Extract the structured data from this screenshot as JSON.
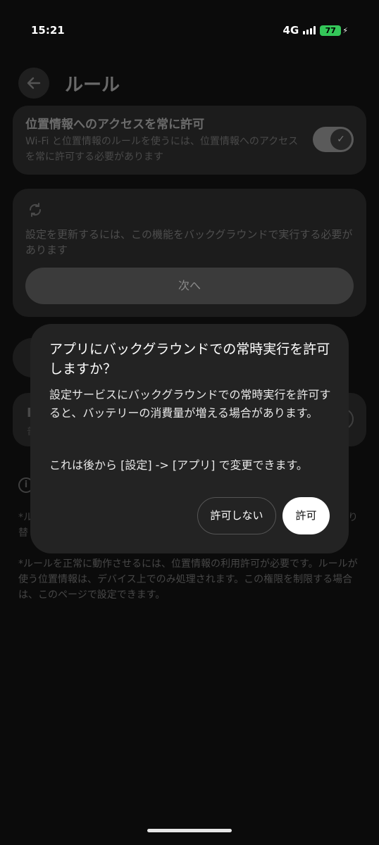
{
  "status_bar": {
    "time": "15:21",
    "network": "4G",
    "battery": "77",
    "battery_color": "#34c759"
  },
  "header": {
    "title": "ルール",
    "back_icon": "arrow-left-icon"
  },
  "location_card": {
    "title": "位置情報へのアクセスを常に許可",
    "subtitle": "Wi-Fi と位置情報のルールを使うには、位置情報へのアクセスを常に許可する必要があります",
    "toggle_checked": true
  },
  "background_card": {
    "icon": "refresh-icon",
    "text": "設定を更新するには、この機能をバックグラウンドで実行する必要があります",
    "next_label": "次へ"
  },
  "hidden_card": {
    "letter": "B",
    "sub": "普"
  },
  "info": {
    "side_left_1": "*ル",
    "side_left_2": "替",
    "side_right_1": "り",
    "note": "*ルールを正常に動作させるには、位置情報の利用許可が必要です。ルールが使う位置情報は、デバイス上でのみ処理されます。この権限を制限する場合は、このページで設定できます。"
  },
  "dialog": {
    "title": "アプリにバックグラウンドでの常時実行を許可しますか？",
    "body": "設定サービスにバックグラウンドでの常時実行を許可すると、バッテリーの消費量が増える場合があります。",
    "note": "これは後から [設定] -> [アプリ] で変更できます。",
    "deny_label": "許可しない",
    "allow_label": "許可"
  }
}
